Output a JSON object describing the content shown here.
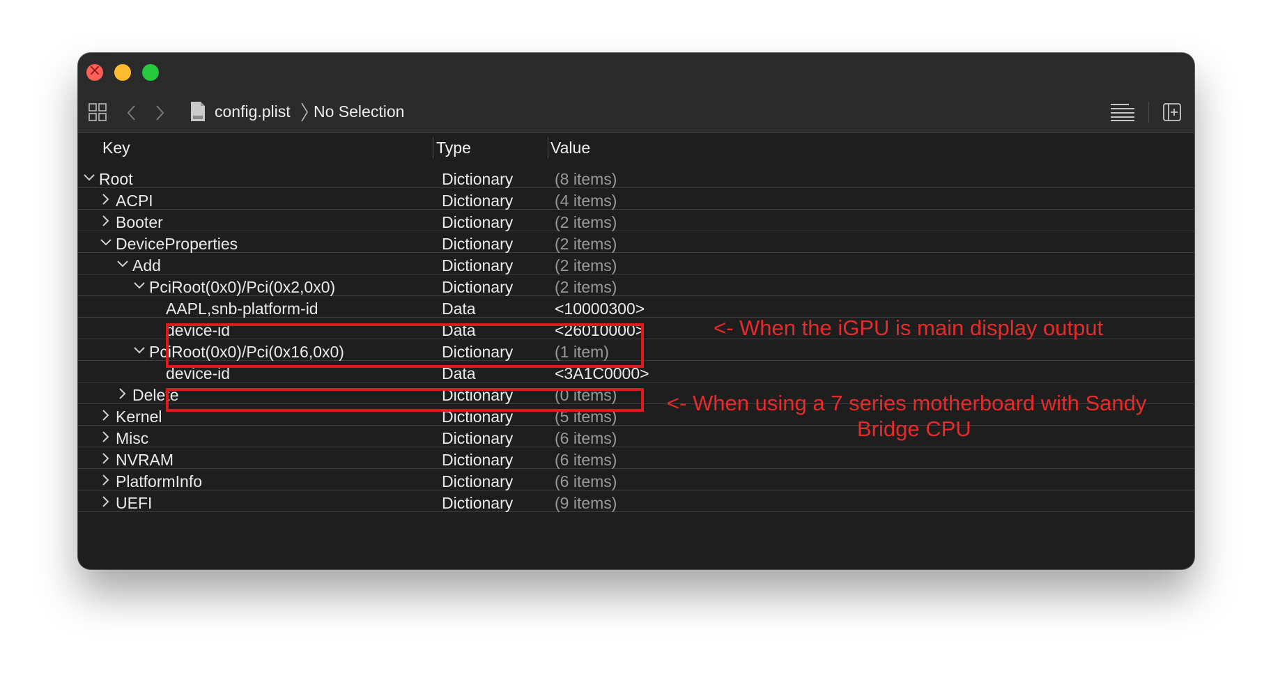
{
  "window": {
    "breadcrumb": {
      "file": "config.plist",
      "selection": "No Selection"
    }
  },
  "columns": {
    "key": "Key",
    "type": "Type",
    "value": "Value"
  },
  "rows": [
    {
      "key": "Root",
      "type": "Dictionary",
      "value": "(8 items)",
      "level": 0,
      "state": "expanded",
      "muted": true
    },
    {
      "key": "ACPI",
      "type": "Dictionary",
      "value": "(4 items)",
      "level": 1,
      "state": "collapsed",
      "muted": true
    },
    {
      "key": "Booter",
      "type": "Dictionary",
      "value": "(2 items)",
      "level": 1,
      "state": "collapsed",
      "muted": true
    },
    {
      "key": "DeviceProperties",
      "type": "Dictionary",
      "value": "(2 items)",
      "level": 1,
      "state": "expanded",
      "muted": true
    },
    {
      "key": "Add",
      "type": "Dictionary",
      "value": "(2 items)",
      "level": 2,
      "state": "expanded",
      "muted": true
    },
    {
      "key": "PciRoot(0x0)/Pci(0x2,0x0)",
      "type": "Dictionary",
      "value": "(2 items)",
      "level": 3,
      "state": "expanded",
      "muted": true
    },
    {
      "key": "AAPL,snb-platform-id",
      "type": "Data",
      "value": "<10000300>",
      "level": 4,
      "state": "leaf",
      "muted": false
    },
    {
      "key": "device-id",
      "type": "Data",
      "value": "<26010000>",
      "level": 4,
      "state": "leaf",
      "muted": false
    },
    {
      "key": "PciRoot(0x0)/Pci(0x16,0x0)",
      "type": "Dictionary",
      "value": "(1 item)",
      "level": 3,
      "state": "expanded",
      "muted": true
    },
    {
      "key": "device-id",
      "type": "Data",
      "value": "<3A1C0000>",
      "level": 4,
      "state": "leaf",
      "muted": false
    },
    {
      "key": "Delete",
      "type": "Dictionary",
      "value": "(0 items)",
      "level": 2,
      "state": "collapsed",
      "muted": true
    },
    {
      "key": "Kernel",
      "type": "Dictionary",
      "value": "(5 items)",
      "level": 1,
      "state": "collapsed",
      "muted": true
    },
    {
      "key": "Misc",
      "type": "Dictionary",
      "value": "(6 items)",
      "level": 1,
      "state": "collapsed",
      "muted": true
    },
    {
      "key": "NVRAM",
      "type": "Dictionary",
      "value": "(6 items)",
      "level": 1,
      "state": "collapsed",
      "muted": true
    },
    {
      "key": "PlatformInfo",
      "type": "Dictionary",
      "value": "(6 items)",
      "level": 1,
      "state": "collapsed",
      "muted": true
    },
    {
      "key": "UEFI",
      "type": "Dictionary",
      "value": "(9 items)",
      "level": 1,
      "state": "collapsed",
      "muted": true
    }
  ],
  "annotations": {
    "igpu_note": "<- When the iGPU is main display output",
    "series7_note_line1": "<- When using a 7 series motherboard with Sandy",
    "series7_note_line2": "Bridge CPU"
  },
  "colors": {
    "annotation": "#e52b2b",
    "highlight_box": "#e0191e",
    "window_bg": "#1e1e1e"
  },
  "icons": [
    "grid-view-icon",
    "back-arrow-icon",
    "forward-arrow-icon",
    "plist-file-icon",
    "list-lines-icon",
    "add-panel-icon",
    "chevron-right-icon",
    "chevron-down-icon"
  ]
}
